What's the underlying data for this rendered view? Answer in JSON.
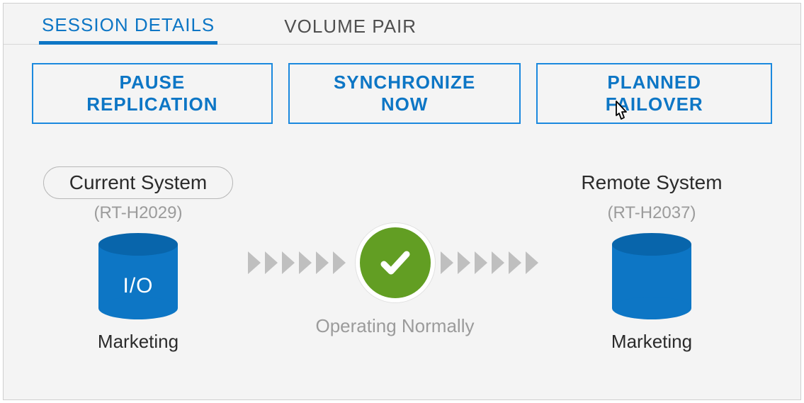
{
  "tabs": {
    "session_details": "SESSION DETAILS",
    "volume_pair": "VOLUME PAIR"
  },
  "actions": {
    "pause_replication": "PAUSE REPLICATION",
    "synchronize_now": "SYNCHRONIZE NOW",
    "planned_failover": "PLANNED FAILOVER"
  },
  "current_system": {
    "title": "Current System",
    "id": "(RT-H2029)",
    "io_label": "I/O",
    "volume_name": "Marketing"
  },
  "remote_system": {
    "title": "Remote System",
    "id": "(RT-H2037)",
    "volume_name": "Marketing"
  },
  "status": {
    "text": "Operating Normally"
  },
  "colors": {
    "blue": "#0d76c5",
    "green": "#629e23"
  }
}
